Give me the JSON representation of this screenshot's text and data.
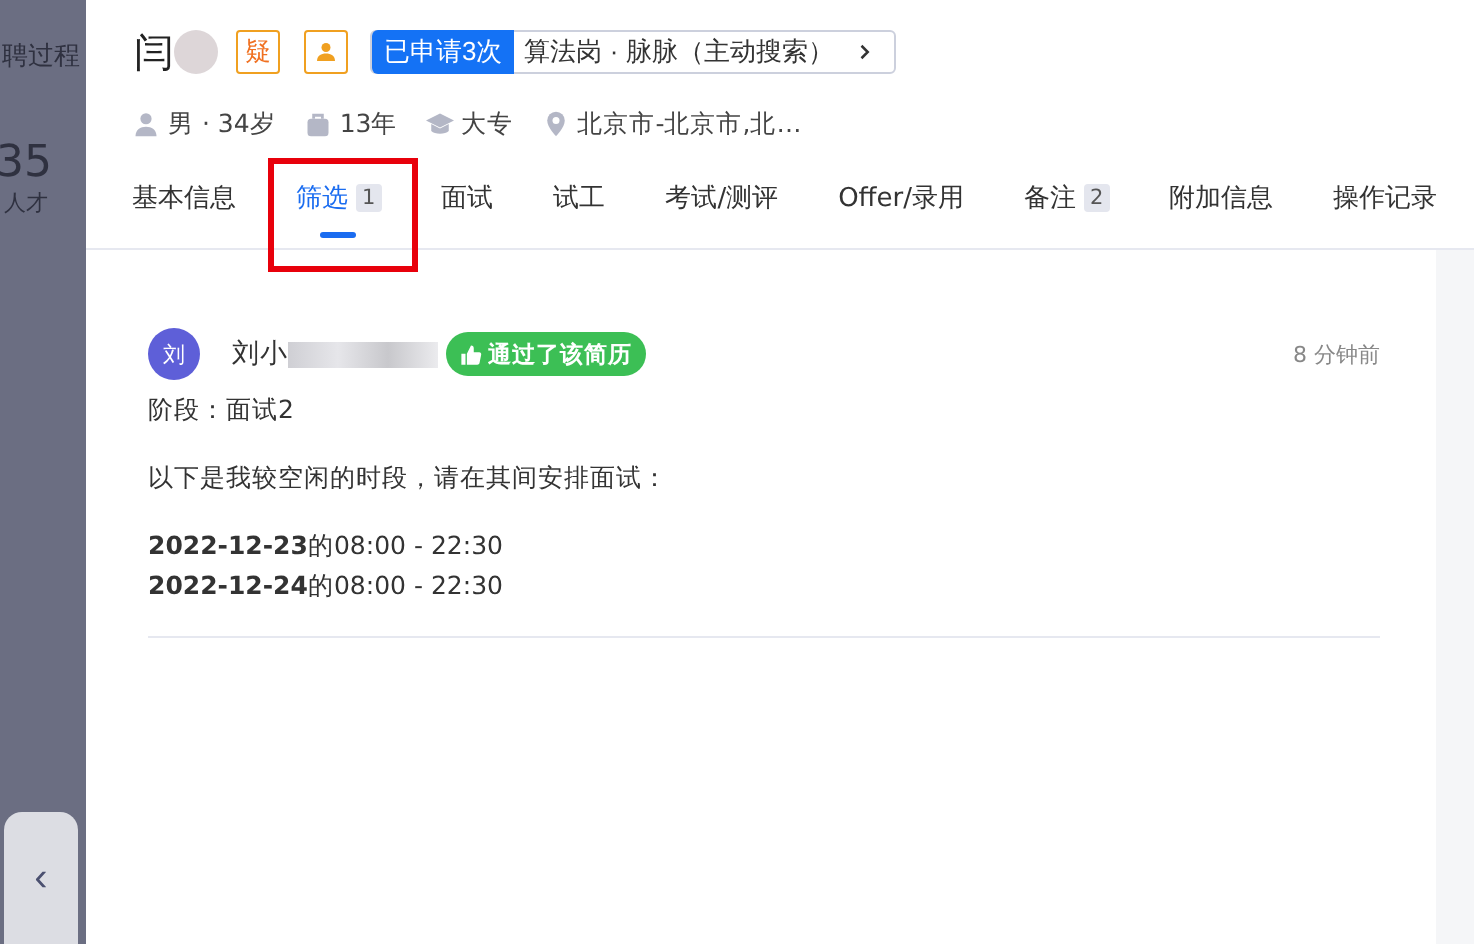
{
  "background_page": {
    "title": "聘过程",
    "count": "35",
    "count_label": "人才",
    "collapse_icon": "‹"
  },
  "candidate": {
    "name": "闫",
    "tag": "疑",
    "applications": "已申请3次",
    "job_source": "算法岗 · 脉脉（主动搜索）"
  },
  "info": [
    {
      "kind": "person",
      "text": "男 · 34岁"
    },
    {
      "kind": "work",
      "text": "13年"
    },
    {
      "kind": "education",
      "text": "大专"
    },
    {
      "kind": "location",
      "text": "北京市-北京市,北…"
    }
  ],
  "tabs": [
    {
      "label": "基本信息",
      "selected": false
    },
    {
      "label": "筛选",
      "count": "1",
      "selected": true,
      "highlighted": true
    },
    {
      "label": "面试",
      "selected": false
    },
    {
      "label": "试工",
      "selected": false
    },
    {
      "label": "考试/测评",
      "selected": false
    },
    {
      "label": "Offer/录用",
      "selected": false
    },
    {
      "label": "备注",
      "count": "2",
      "selected": false
    },
    {
      "label": "附加信息",
      "selected": false
    },
    {
      "label": "操作记录",
      "selected": false
    }
  ],
  "feedback": {
    "avatar": "刘",
    "author": "刘小",
    "verdict": "通过了该简历",
    "time": "8 分钟前",
    "stage": "阶段：面试2",
    "message": "以下是我较空闲的时段，请在其间安排面试：",
    "slots": [
      "**2022-12-23**的08:00 - 22:30",
      "**2022-12-24**的08:00 - 22:30"
    ]
  }
}
